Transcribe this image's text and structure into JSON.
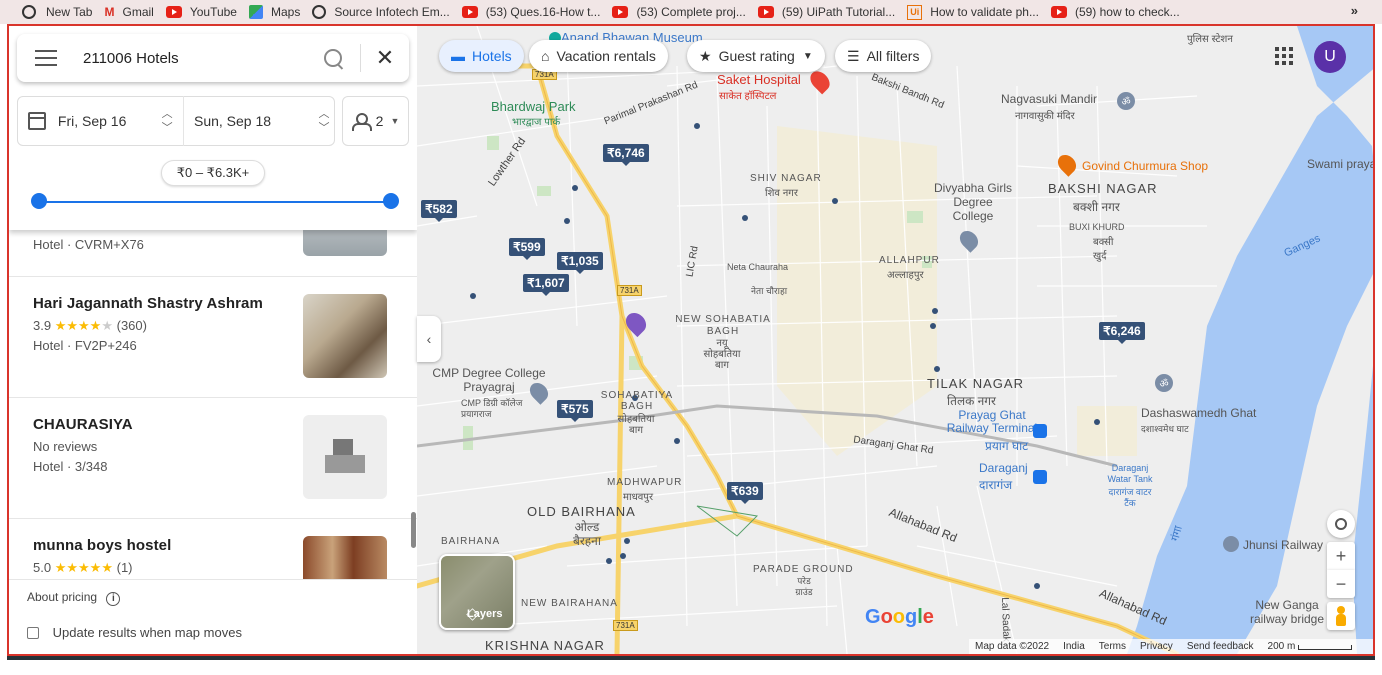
{
  "bookmarks": [
    {
      "label": "New Tab",
      "icon": "globe-icon"
    },
    {
      "label": "Gmail",
      "icon": "gmail-icon"
    },
    {
      "label": "YouTube",
      "icon": "youtube-icon"
    },
    {
      "label": "Maps",
      "icon": "maps-icon"
    },
    {
      "label": "Source Infotech Em...",
      "icon": "globe-icon"
    },
    {
      "label": "(53) Ques.16-How t...",
      "icon": "youtube-icon"
    },
    {
      "label": "(53) Complete proj...",
      "icon": "youtube-icon"
    },
    {
      "label": "(59) UiPath Tutorial...",
      "icon": "youtube-icon"
    },
    {
      "label": "How to validate ph...",
      "icon": "uipath-icon"
    },
    {
      "label": "(59) how to check...",
      "icon": "youtube-icon"
    }
  ],
  "bookmarks_more": "»",
  "search": {
    "query": "211006 Hotels"
  },
  "dates": {
    "checkin": "Fri, Sep 16",
    "checkout": "Sun, Sep 18"
  },
  "guests": "2",
  "price_range": "₹0 – ₹6.3K+",
  "chips": {
    "hotels": "Hotels",
    "vacation": "Vacation rentals",
    "guest_rating": "Guest rating",
    "all_filters": "All filters"
  },
  "avatar_letter": "U",
  "listings": [
    {
      "name": "",
      "rating": "",
      "reviews": "",
      "type": "Hotel · CVRM+X76"
    },
    {
      "name": "Hari Jagannath Shastry Ashram",
      "rating": "3.9",
      "stars": 4,
      "reviews": "(360)",
      "type": "Hotel · FV2P+246"
    },
    {
      "name": "CHAURASIYA",
      "rating": "No reviews",
      "stars": 0,
      "reviews": "",
      "type": "Hotel · 3/348"
    },
    {
      "name": "munna boys hostel",
      "rating": "5.0",
      "stars": 5,
      "reviews": "(1)",
      "type": ""
    }
  ],
  "pricing": {
    "about": "About pricing",
    "update": "Update results when map moves"
  },
  "map_prices": [
    "₹6,746",
    "₹582",
    "₹599",
    "₹1,035",
    "₹1,607",
    "₹6,246",
    "₹575",
    "₹639"
  ],
  "map_labels": {
    "anand": "Anand Bhawan Museum",
    "bhardwaj": "Bhardwaj Park",
    "bhardwaj_hi": "भारद्वाज पार्क",
    "saket": "Saket Hospital",
    "saket_hi": "साकेत हॉस्पिटल",
    "nagvasuki": "Nagvasuki Mandir",
    "nagvasuki_hi": "नागवासुकी मंदिर",
    "police": "पुलिस स्टेशन",
    "govind": "Govind Churmura Shop",
    "swami": "Swami praya",
    "shiv": "SHIV NAGAR",
    "shiv_hi": "शिव नगर",
    "divyabha": "Divyabha Girls Degree College",
    "bakshi": "BAKSHI NAGAR",
    "bakshi_hi": "बक्शी नगर",
    "buxi": "BUXI KHURD",
    "buxi_hi": "बक्सी खुर्द",
    "ganges": "Ganges",
    "neta": "Neta Chauraha",
    "neta_hi": "नेता चौराहा",
    "allahpur": "ALLAHPUR",
    "allahpur_hi": "अल्लाहपुर",
    "new_soh": "NEW SOHABATIA BAGH",
    "new_soh_hi": "नयू सोहबतिया बाग",
    "cmp": "CMP Degree College Prayagraj",
    "cmp_hi": "CMP डिग्री कॉलेज प्रयागराज",
    "soh": "SOHABATIYA BAGH",
    "soh_hi": "सोहबतिया बाग",
    "tilak": "TILAK NAGAR",
    "tilak_hi": "तिलक नगर",
    "prayag": "Prayag Ghat Railway Terminal",
    "prayag_hi": "प्रयाग घाट",
    "dasha": "Dashaswamedh Ghat",
    "dasha_hi": "दशाश्वमेध घाट",
    "daraganj": "Daraganj",
    "daraganj_hi": "दारागंज",
    "daraganj_wt": "Daraganj Watar Tank",
    "daraganj_wt_hi": "दारागंज वाटर टैंक",
    "madhwapur": "MADHWAPUR",
    "madhwapur_hi": "माधवपुर",
    "old_bairhana": "OLD BAIRHANA",
    "old_bairhana_hi": "ओल्ड बैरहना",
    "parade": "PARADE GROUND",
    "parade_hi": "परेड ग्राउंड",
    "bairhana": "BAIRHANA",
    "new_bairhana": "NEW BAIRAHANA",
    "krishna": "KRISHNA NAGAR",
    "ganga": "गंगा",
    "jhunsi": "Jhunsi Railway",
    "newganga": "New Ganga railway bridge",
    "kasba": "...",
    "roads": {
      "lowther": "Lowther Rd",
      "parimal": "Parimal Prakashan Rd",
      "bakshi_bandh": "Bakshi Bandh Rd",
      "lic": "LIC Rd",
      "daraganj_ghat": "Daraganj Ghat Rd",
      "allahabad1": "Allahabad Rd",
      "allahabad2": "Allahabad Rd",
      "lal": "Lal Sadak",
      "r731a": "731A",
      "r731a_2": "731A",
      "r731a_3": "731A"
    }
  },
  "map_footer": {
    "data": "Map data ©2022",
    "country": "India",
    "terms": "Terms",
    "privacy": "Privacy",
    "feedback": "Send feedback",
    "scale": "200 m"
  },
  "layers_label": "Layers",
  "google": "Google"
}
